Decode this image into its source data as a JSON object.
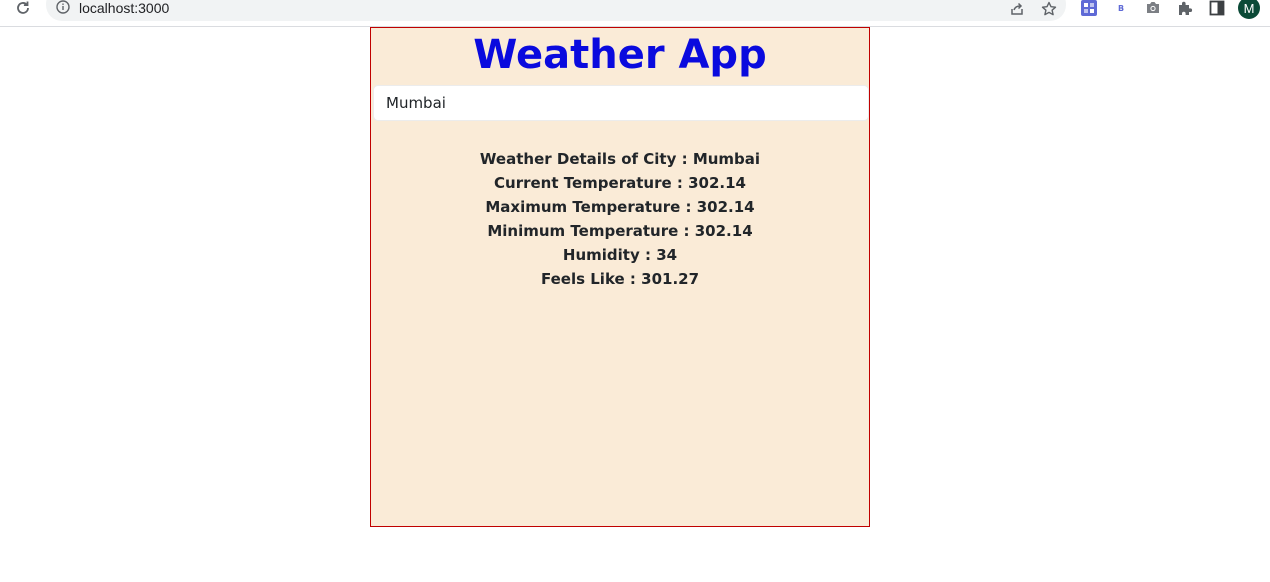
{
  "browser": {
    "url": "localhost:3000",
    "extensions": [
      {
        "name": "extension-puzzle-grid",
        "color": "#5f6ad6"
      },
      {
        "name": "extension-b",
        "label": "B"
      },
      {
        "name": "camera"
      },
      {
        "name": "extensions-puzzle"
      },
      {
        "name": "side-panel"
      }
    ],
    "profile_initial": "M",
    "profile_color": "#0b4a37"
  },
  "app": {
    "title": "Weather App",
    "title_color": "#0a0ade",
    "panel_background": "#faebd7",
    "panel_border_color": "#c00000",
    "city_input_value": "Mumbai",
    "details": {
      "city_line": "Weather Details of City : Mumbai",
      "current_temp_line": "Current Temperature : 302.14",
      "max_temp_line": "Maximum Temperature : 302.14",
      "min_temp_line": "Minimum Temperature : 302.14",
      "humidity_line": "Humidity : 34",
      "feels_like_line": "Feels Like : 301.27"
    }
  }
}
